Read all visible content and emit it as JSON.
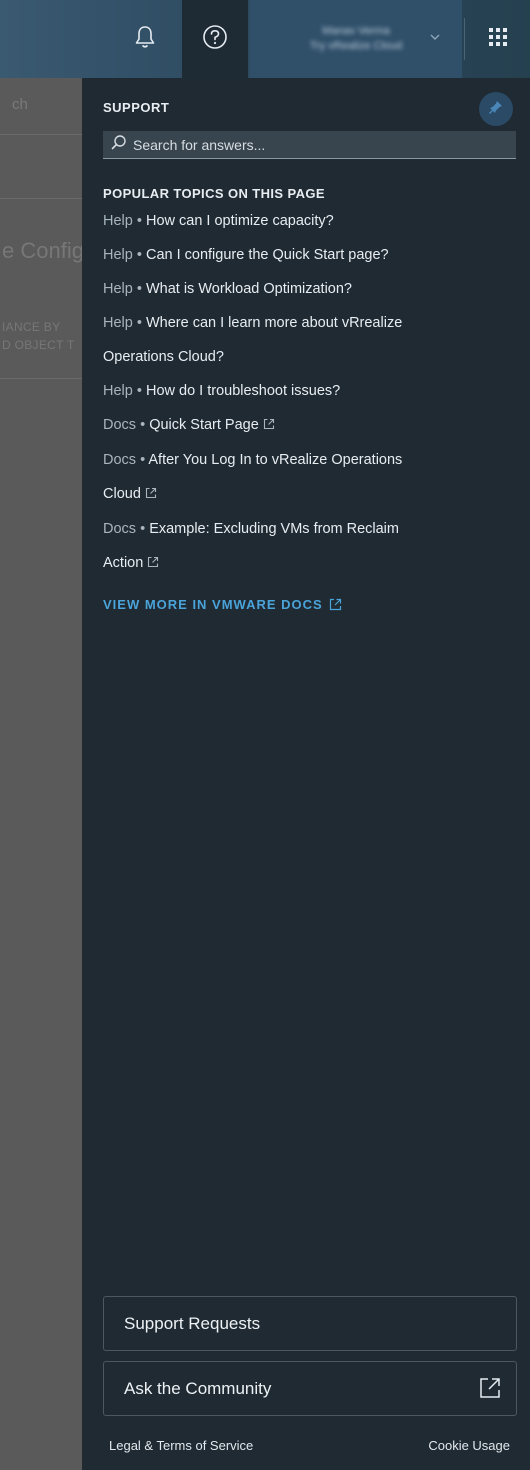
{
  "header": {
    "icons": {
      "notifications": "bell-icon",
      "help": "help-circle-icon",
      "apps": "grid-icon"
    },
    "user": {
      "name": "Manav Verma",
      "subtitle": "Try vRealize Cloud"
    }
  },
  "background": {
    "search_fragment": "ch",
    "title_fragment": "e Config",
    "label_line1": "IANCE BY",
    "label_line2": "D OBJECT T"
  },
  "panel": {
    "title": "SUPPORT",
    "search_placeholder": "Search for answers...",
    "section_title": "POPULAR TOPICS ON THIS PAGE",
    "topics": [
      {
        "type": "Help",
        "text": "How can I optimize capacity?",
        "external": false
      },
      {
        "type": "Help",
        "text": "Can I configure the Quick Start page?",
        "external": false
      },
      {
        "type": "Help",
        "text": "What is Workload Optimization?",
        "external": false
      },
      {
        "type": "Help",
        "text": "Where can I learn more about vRrealize",
        "external": false
      },
      {
        "type": "",
        "text": "Operations Cloud?",
        "external": false
      },
      {
        "type": "Help",
        "text": "How do I troubleshoot issues?",
        "external": false
      },
      {
        "type": "Docs",
        "text": "Quick Start Page",
        "external": true
      },
      {
        "type": "Docs",
        "text": "After You Log In to vRealize Operations",
        "external": false
      },
      {
        "type": "",
        "text": "Cloud",
        "external": true
      },
      {
        "type": "Docs",
        "text": "Example: Excluding VMs from Reclaim",
        "external": false
      },
      {
        "type": "",
        "text": "Action",
        "external": true
      }
    ],
    "view_more": "VIEW MORE IN VMWARE DOCS",
    "support_requests": "Support Requests",
    "ask_community": "Ask the Community",
    "legal": "Legal & Terms of Service",
    "cookie": "Cookie Usage"
  },
  "colors": {
    "panel_bg": "#1f2a33",
    "header_bg": "#2e4b61",
    "link_blue": "#4aa3d9",
    "topic_type": "#a9b5be"
  }
}
